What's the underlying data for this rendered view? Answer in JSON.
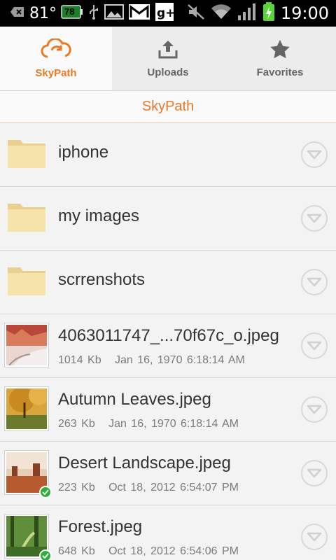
{
  "status_bar": {
    "temperature": "81°",
    "battery_left": "78",
    "time": "19:00"
  },
  "tabs": [
    {
      "label": "SkyPath",
      "icon": "cloud-sync-icon",
      "active": true
    },
    {
      "label": "Uploads",
      "icon": "upload-icon",
      "active": false
    },
    {
      "label": "Favorites",
      "icon": "star-icon",
      "active": false
    }
  ],
  "path_title": "SkyPath",
  "items": [
    {
      "type": "folder",
      "name": "iphone"
    },
    {
      "type": "folder",
      "name": "my images"
    },
    {
      "type": "folder",
      "name": "scrrenshots"
    },
    {
      "type": "file",
      "name": "4063011747_...70f67c_o.jpeg",
      "size": "1014 Kb",
      "date": "Jan 16, 1970 6:18:14 AM",
      "synced": false
    },
    {
      "type": "file",
      "name": "Autumn Leaves.jpeg",
      "size": "263 Kb",
      "date": "Jan 16, 1970 6:18:14 AM",
      "synced": false
    },
    {
      "type": "file",
      "name": "Desert Landscape.jpeg",
      "size": "223 Kb",
      "date": "Oct 18, 2012 6:54:07 PM",
      "synced": true
    },
    {
      "type": "file",
      "name": "Forest.jpeg",
      "size": "648 Kb",
      "date": "Oct 18, 2012 6:54:06 PM",
      "synced": true
    }
  ],
  "colors": {
    "accent": "#ea7a26",
    "sync_ok": "#2dae3c"
  }
}
